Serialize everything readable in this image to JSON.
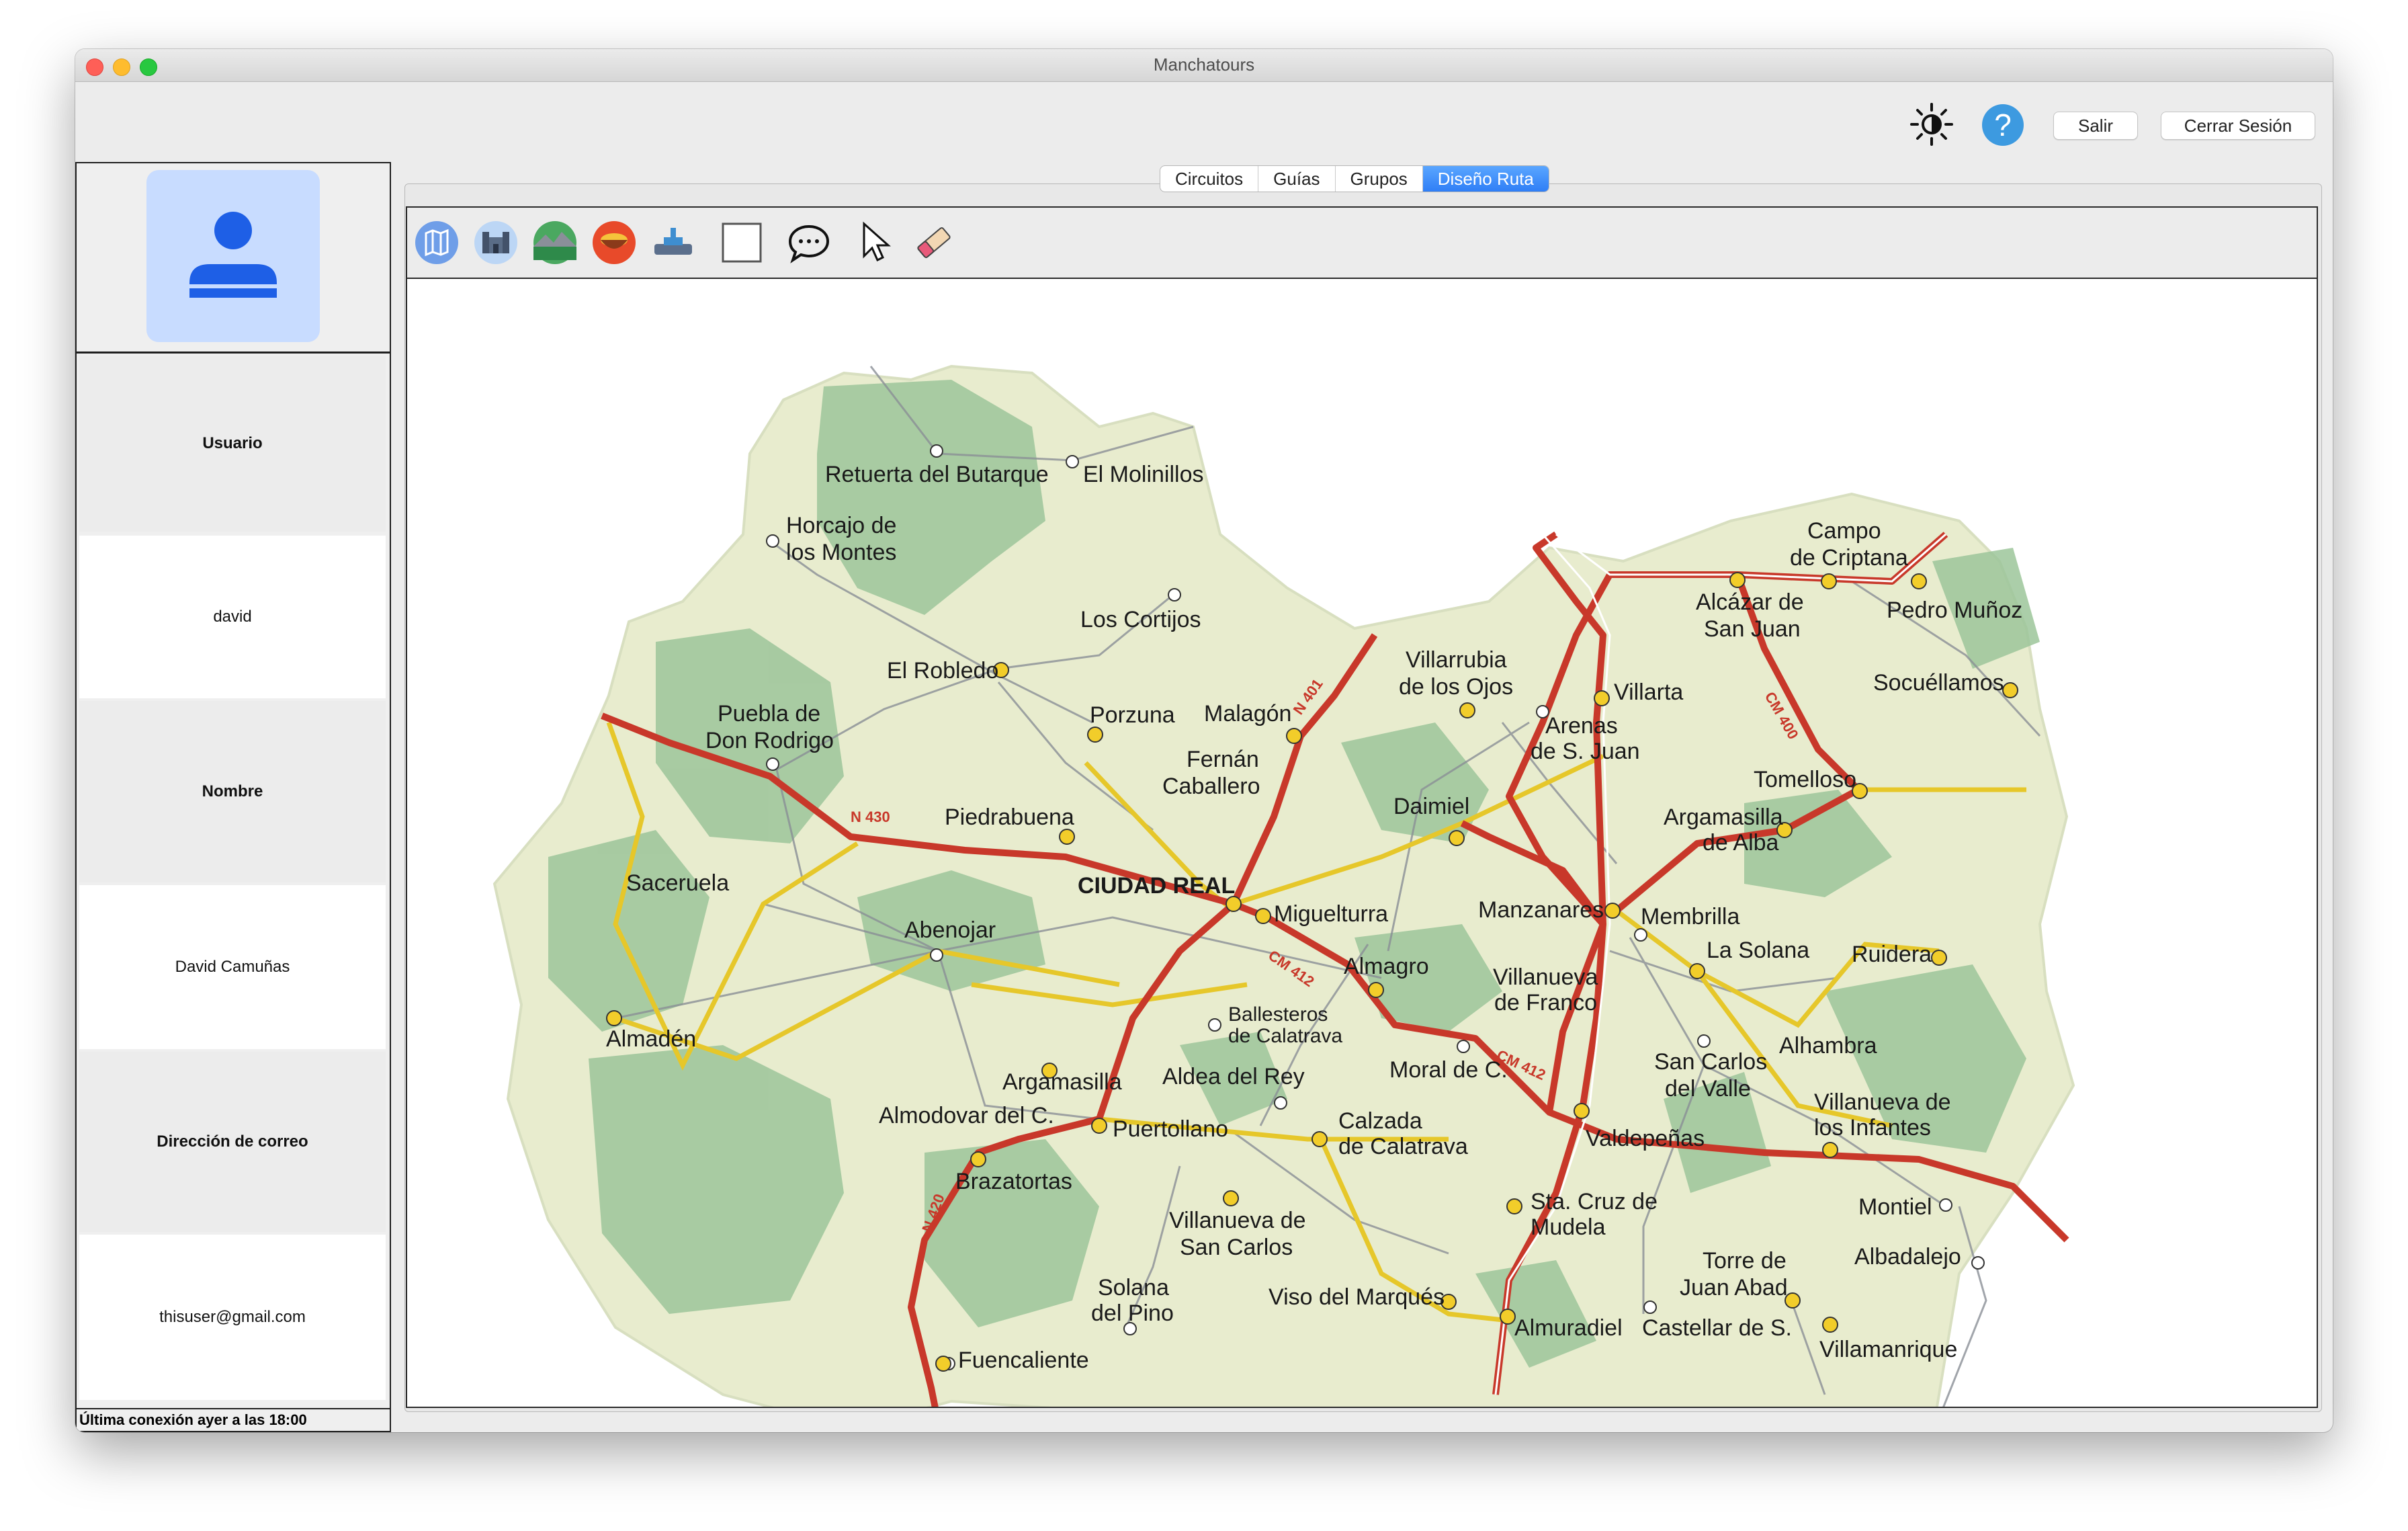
{
  "window": {
    "title": "Manchatours"
  },
  "topbar": {
    "brightness_icon": "brightness-icon",
    "help_icon": "help-icon",
    "help_glyph": "?",
    "salir_label": "Salir",
    "cerrar_sesion_label": "Cerrar Sesión"
  },
  "user_panel": {
    "avatar_icon": "user-avatar-icon",
    "fields": [
      {
        "label": "Usuario",
        "value": "david"
      },
      {
        "label": "Nombre",
        "value": "David Camuñas"
      },
      {
        "label": "Dirección de correo",
        "value": "thisuser@gmail.com"
      }
    ],
    "status": "Última conexión ayer a las 18:00"
  },
  "tabs": [
    {
      "label": "Circuitos",
      "active": false
    },
    {
      "label": "Guías",
      "active": false
    },
    {
      "label": "Grupos",
      "active": false
    },
    {
      "label": "Diseño Ruta",
      "active": true
    }
  ],
  "toolbar": {
    "tools": [
      "map-route-icon",
      "castle-icon",
      "landscape-icon",
      "food-icon",
      "monument-icon",
      "rectangle-icon",
      "comment-icon",
      "pointer-icon",
      "eraser-icon"
    ]
  },
  "map": {
    "road_labels": [
      "N 430",
      "N 401",
      "CM 400",
      "CM 412",
      "CM 412",
      "N 420"
    ],
    "places": [
      "Retuerta del Butarque",
      "El Molinillos",
      "Horcajo de",
      "los Montes",
      "Los Cortijos",
      "El Robledo",
      "Puebla de",
      "Don Rodrigo",
      "Porzuna",
      "Malagón",
      "Fernán",
      "Caballero",
      "Piedrabuena",
      "Villarrubia",
      "de los Ojos",
      "Arenas",
      "de S. Juan",
      "Villarta",
      "Campo",
      "de Criptana",
      "Alcázar de",
      "San Juan",
      "Pedro Muñoz",
      "Socuéllamos",
      "Tomelloso",
      "Argamasilla",
      "de Alba",
      "Daimiel",
      "CIUDAD REAL",
      "Miguelturra",
      "Saceruela",
      "Abenojar",
      "Almadén",
      "Manzanares",
      "Membrilla",
      "La Solana",
      "Ruidera",
      "Almagro",
      "Villanueva",
      "de Franco",
      "Ballesteros",
      "de Calatrava",
      "Argamasilla",
      "Aldea del Rey",
      "Moral de C.",
      "Alhambra",
      "San Carlos",
      "del Valle",
      "Almodovar del C.",
      "Puertollano",
      "Calzada",
      "de Calatrava",
      "Valdepeñas",
      "Villanueva de",
      "los Infantes",
      "Brazatortas",
      "Villanueva de",
      "San Carlos",
      "Sta. Cruz de",
      "Mudela",
      "Montiel",
      "Albadalejo",
      "Solana",
      "del Pino",
      "Viso del Marqués",
      "Torre de",
      "Juan Abad",
      "Almuradiel",
      "Castellar de S.",
      "Villamanrique",
      "Fuencaliente"
    ]
  }
}
